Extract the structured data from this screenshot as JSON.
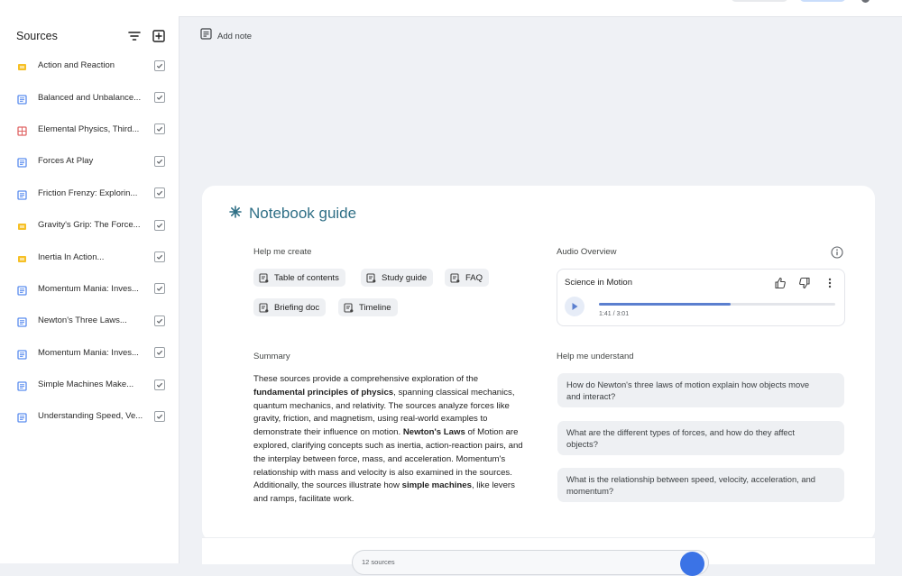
{
  "sidebar": {
    "title": "Sources",
    "icons": {
      "filter": "filter-icon",
      "add": "add-box-icon"
    },
    "items": [
      {
        "label": "Action and Reaction",
        "icon": "slides-icon",
        "color": "#f6c026",
        "checked": true
      },
      {
        "label": "Balanced and Unbalance...",
        "icon": "doc-icon",
        "color": "#5b8def",
        "checked": true
      },
      {
        "label": "Elemental Physics, Third...",
        "icon": "pdf-icon",
        "color": "#e06666",
        "checked": true
      },
      {
        "label": "Forces At Play",
        "icon": "doc-icon",
        "color": "#5b8def",
        "checked": true
      },
      {
        "label": "Friction Frenzy: Explorin...",
        "icon": "doc-icon",
        "color": "#5b8def",
        "checked": true
      },
      {
        "label": "Gravity's Grip: The Force...",
        "icon": "slides-icon",
        "color": "#f6c026",
        "checked": true
      },
      {
        "label": "Inertia In Action...",
        "icon": "slides-icon",
        "color": "#f6c026",
        "checked": true
      },
      {
        "label": "Momentum Mania: Inves...",
        "icon": "doc-icon",
        "color": "#5b8def",
        "checked": true
      },
      {
        "label": "Newton's Three Laws...",
        "icon": "doc-icon",
        "color": "#5b8def",
        "checked": true
      },
      {
        "label": "Momentum Mania: Inves...",
        "icon": "doc-icon",
        "color": "#5b8def",
        "checked": true
      },
      {
        "label": "Simple Machines Make...",
        "icon": "doc-icon",
        "color": "#5b8def",
        "checked": true
      },
      {
        "label": "Understanding Speed, Ve...",
        "icon": "doc-icon",
        "color": "#5b8def",
        "checked": true
      }
    ]
  },
  "notes": {
    "add_note_label": "Add note",
    "icon": "note-add-icon"
  },
  "guide": {
    "title": "Notebook guide",
    "title_icon": "sparkle-icon",
    "accent": "#2f6f86",
    "help_create": {
      "label": "Help me create",
      "chips": [
        "Table of contents",
        "Study guide",
        "FAQ",
        "Briefing doc",
        "Timeline"
      ]
    },
    "summary": {
      "label": "Summary",
      "parts": [
        {
          "text": "These sources provide a comprehensive exploration of the ",
          "bold": false
        },
        {
          "text": "fundamental principles of physics",
          "bold": true
        },
        {
          "text": ", spanning classical mechanics, quantum mechanics, and relativity. The sources analyze forces like gravity, friction, and magnetism, using real-world examples to demonstrate their influence on motion. ",
          "bold": false
        },
        {
          "text": "Newton's Laws",
          "bold": true
        },
        {
          "text": " of Motion are explored, clarifying concepts such as inertia, action-reaction pairs, and the interplay between force, mass, and acceleration. Momentum's relationship with mass and velocity is also examined in the sources. Additionally, the sources illustrate how ",
          "bold": false
        },
        {
          "text": "simple machines",
          "bold": true
        },
        {
          "text": ", like levers and ramps, facilitate work.",
          "bold": false
        }
      ]
    },
    "audio": {
      "label": "Audio Overview",
      "title": "Science in Motion",
      "time": "1:41 / 3:01",
      "progress": 0.558,
      "accent": "#5b7fcf"
    },
    "understand": {
      "label": "Help me understand",
      "questions": [
        "How do Newton's three laws of motion explain how objects move and interact?",
        "What are the different types of forces, and how do they affect objects?",
        "What is the relationship between speed, velocity, acceleration, and momentum?"
      ]
    }
  },
  "chat": {
    "view_chat_label": "",
    "source_count_label": "12 sources",
    "guide_label": ""
  }
}
